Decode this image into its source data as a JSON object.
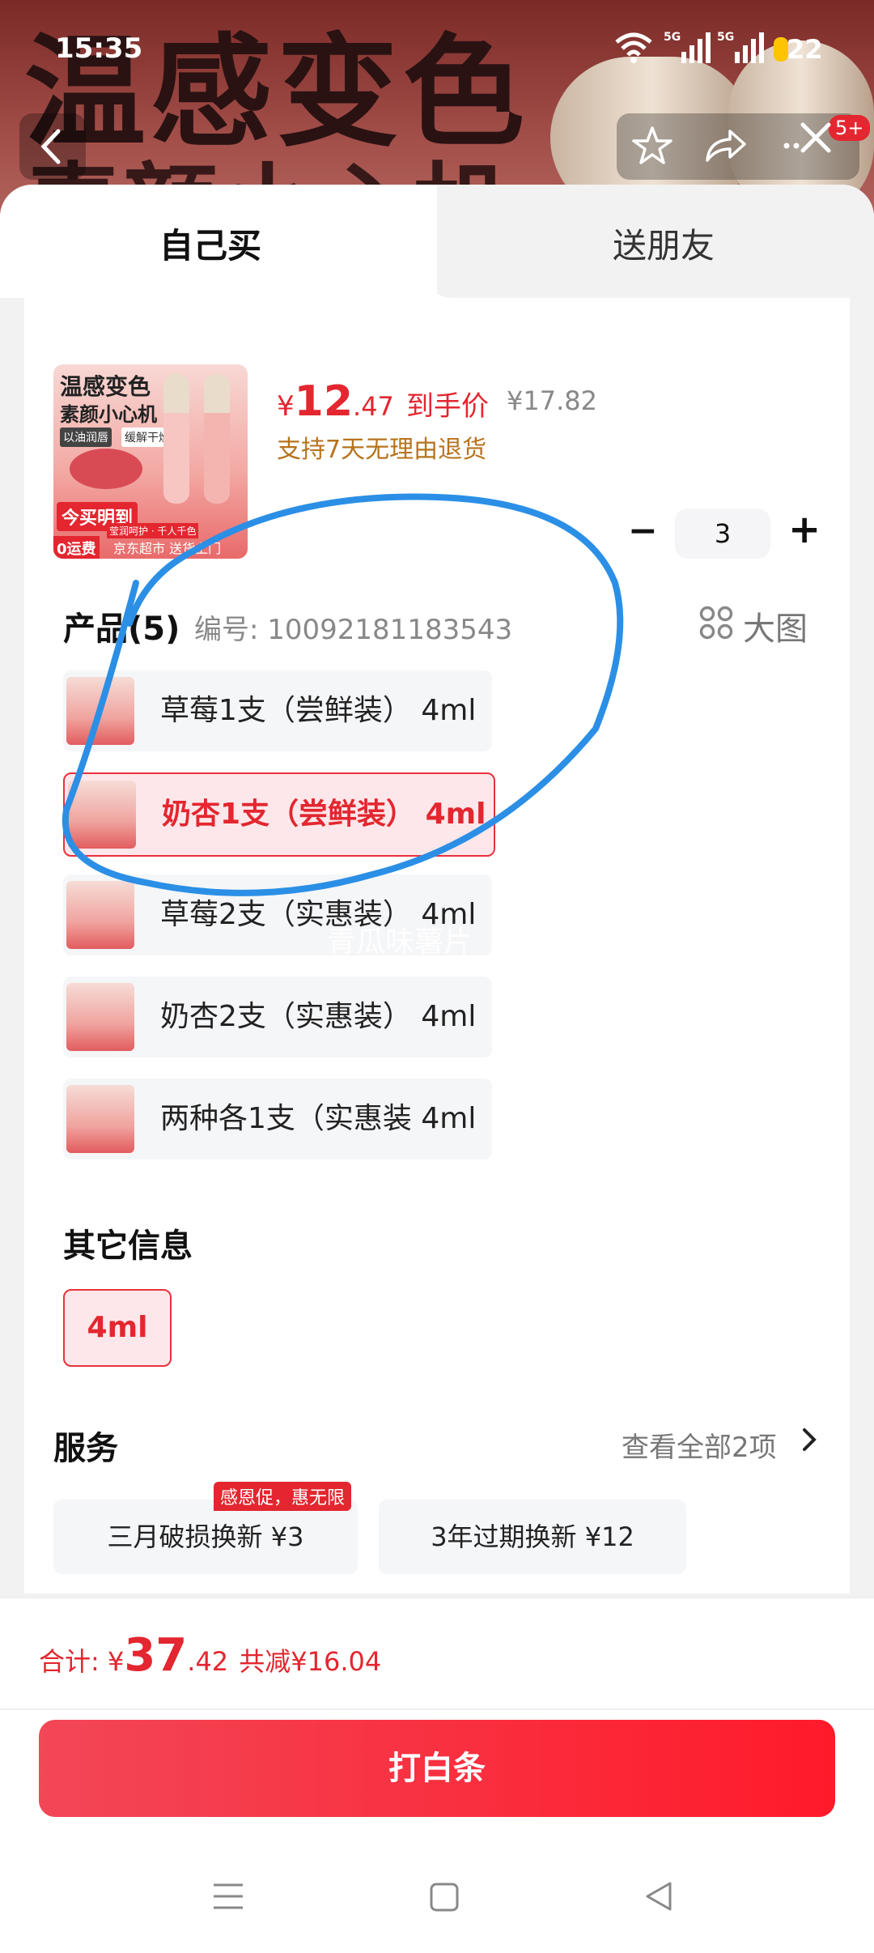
{
  "status_bar": {
    "time": "15:35",
    "signal1": "5G",
    "signal2": "5G",
    "battery": "22"
  },
  "banner": {
    "headline": "温感变色",
    "subline": "素颜小心机"
  },
  "top_nav": {
    "badge": "5+"
  },
  "tabs": [
    {
      "label": "自己买",
      "active": true
    },
    {
      "label": "送朋友",
      "active": false
    }
  ],
  "product": {
    "price_symbol": "¥",
    "price_int": "12",
    "price_dec": ".47",
    "price_tag": "到手价",
    "original_price": "¥17.82",
    "return_policy": "支持7天无理由退货",
    "thumb_title1": "温感变色",
    "thumb_title2": "素颜小心机",
    "thumb_badge1": "以油润唇",
    "thumb_badge2": "缓解干燥",
    "thumb_promo": "今买明到",
    "thumb_free": "0运费",
    "thumb_footer": "京东超市 送货上门",
    "thumb_caption": "莹润呵护 · 千人千色"
  },
  "quantity": {
    "minus": "−",
    "value": "3",
    "plus": "+"
  },
  "sku_section": {
    "title": "产品(5)",
    "code": "编号: 10092181183543",
    "view_large": "大图",
    "items": [
      {
        "label": "草莓1支（尝鲜装） 4ml",
        "selected": false
      },
      {
        "label": "奶杏1支（尝鲜装） 4ml",
        "selected": true
      },
      {
        "label": "草莓2支（实惠装） 4ml",
        "selected": false
      },
      {
        "label": "奶杏2支（实惠装） 4ml",
        "selected": false
      },
      {
        "label": "两种各1支（实惠装 4ml",
        "selected": false
      }
    ],
    "watermark": "青瓜味薯片"
  },
  "other_info": {
    "title": "其它信息",
    "option": "4ml"
  },
  "services": {
    "title": "服务",
    "view_all": "查看全部2项",
    "items": [
      {
        "label": "三月破损换新  ¥3",
        "badge": "感恩促，惠无限"
      },
      {
        "label": "3年过期换新  ¥12"
      }
    ]
  },
  "total": {
    "label": "合计: ",
    "symbol": "¥",
    "int": "37",
    "dec": ".42",
    "discount": "共减¥16.04"
  },
  "pay_button": "打白条",
  "colors": {
    "accent": "#e3262f",
    "annotation": "#2b8fe6",
    "gold": "#b7731c"
  }
}
